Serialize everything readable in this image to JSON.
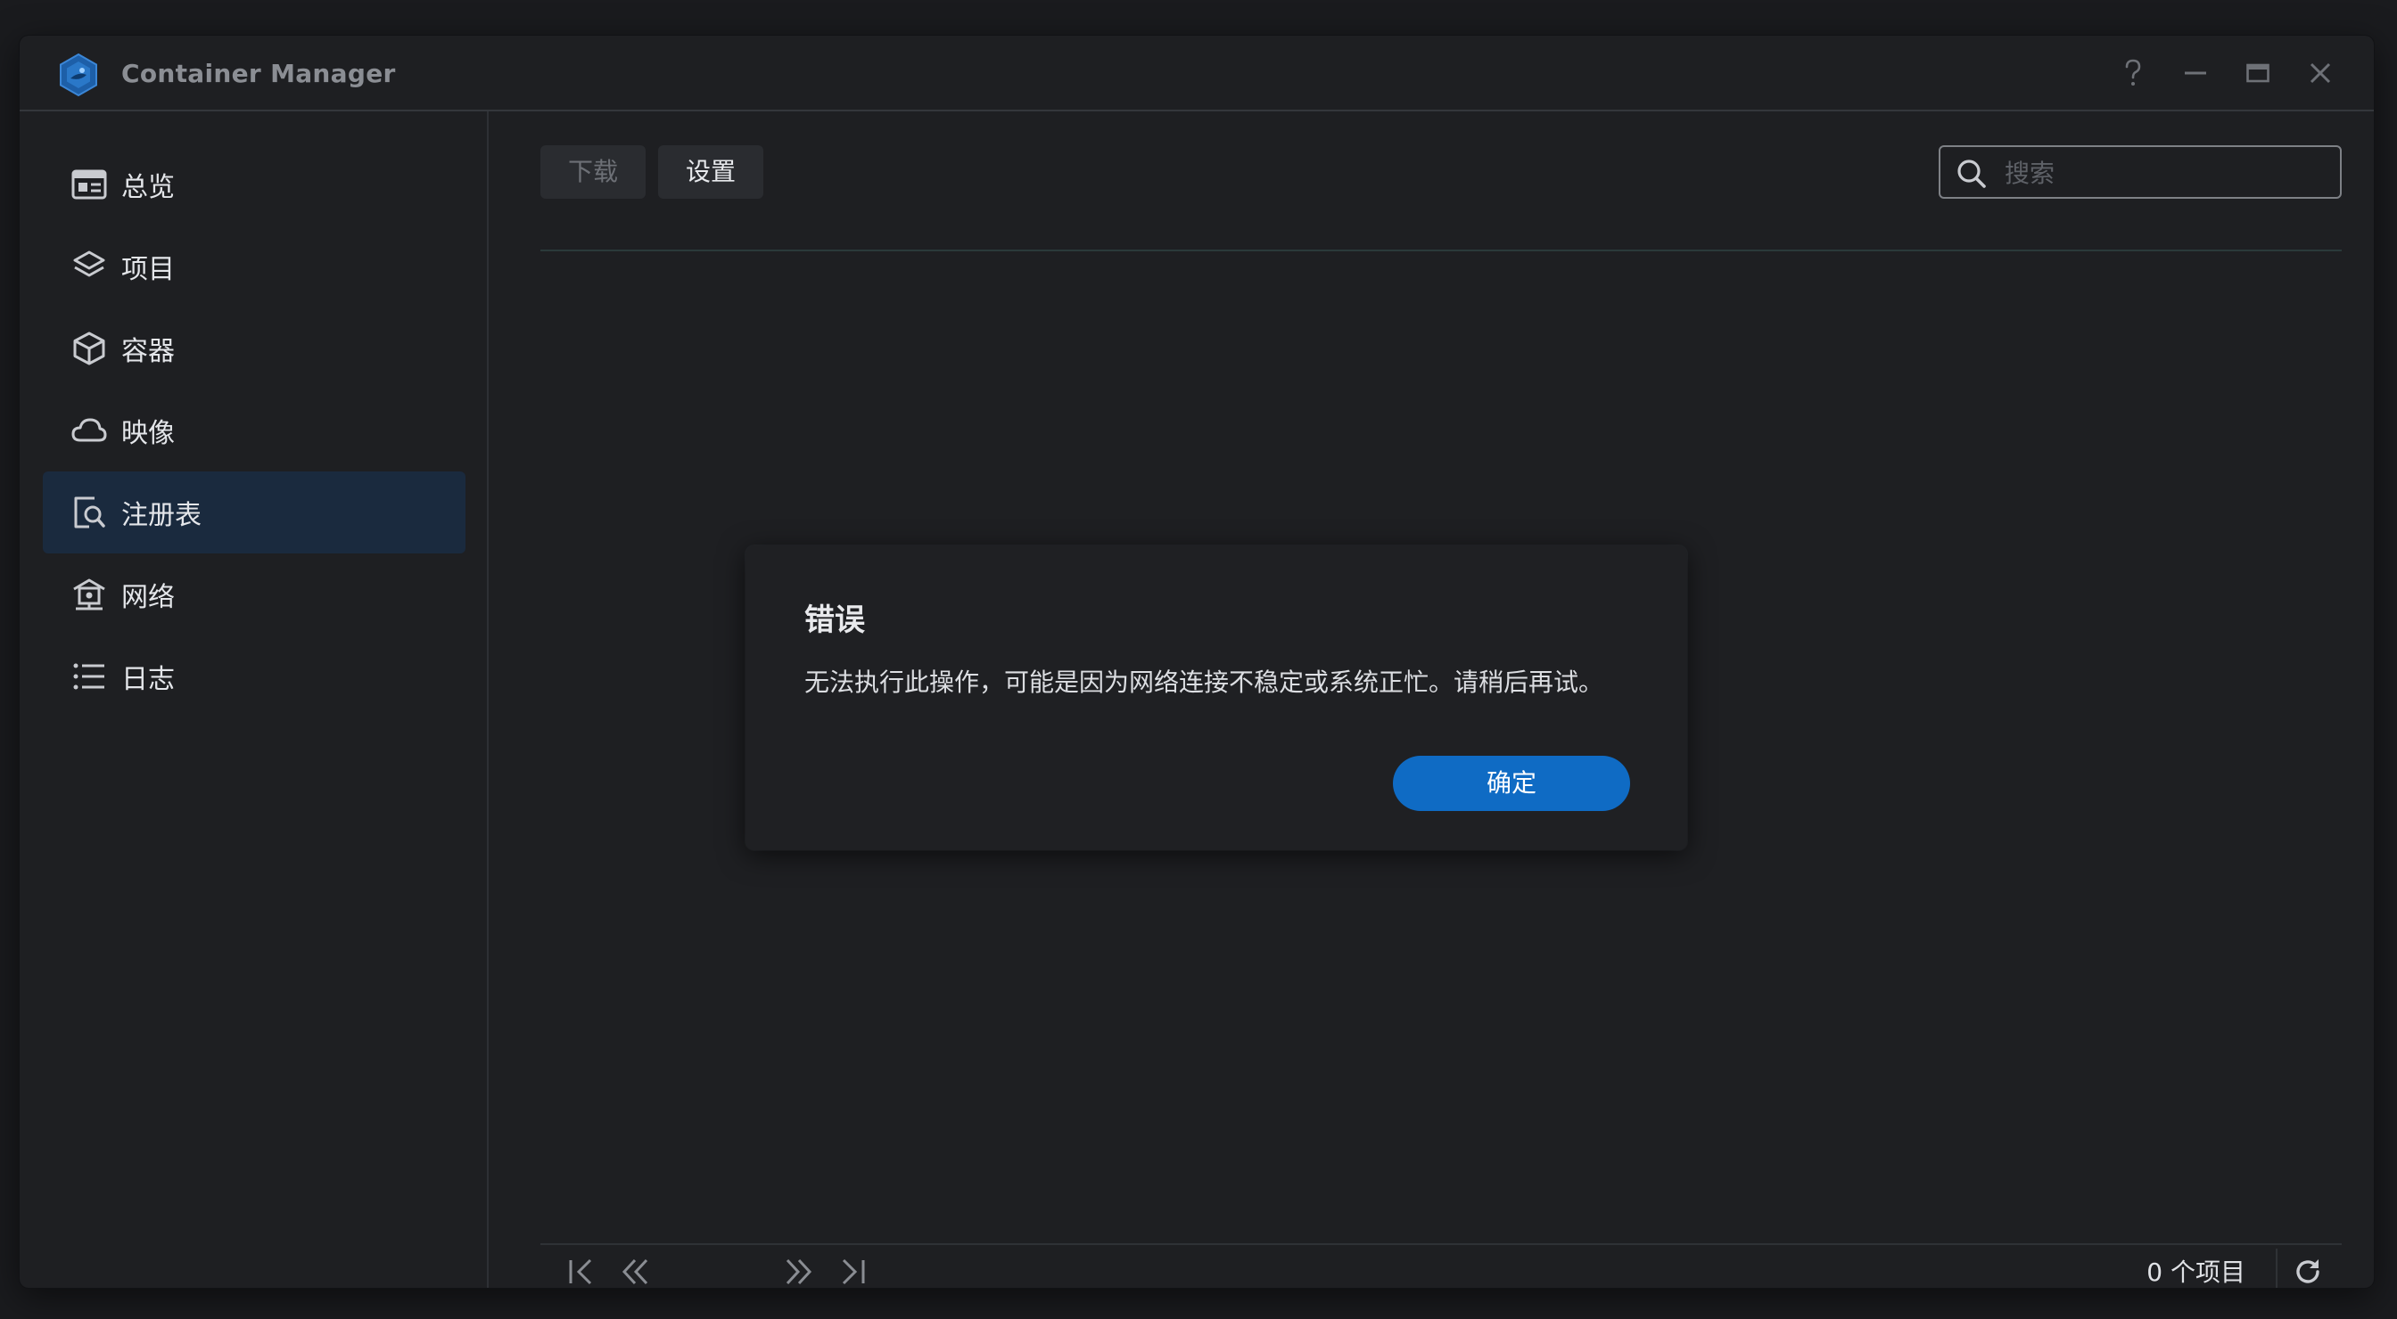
{
  "window": {
    "title": "Container Manager",
    "controls": [
      "help-icon",
      "minimize-icon",
      "maximize-icon",
      "close-icon"
    ]
  },
  "sidebar": {
    "items": [
      {
        "label": "总览",
        "icon": "overview-icon",
        "active": false
      },
      {
        "label": "项目",
        "icon": "layers-icon",
        "active": false
      },
      {
        "label": "容器",
        "icon": "cube-icon",
        "active": false
      },
      {
        "label": "映像",
        "icon": "cloud-icon",
        "active": false
      },
      {
        "label": "注册表",
        "icon": "registry-search-icon",
        "active": true
      },
      {
        "label": "网络",
        "icon": "network-house-icon",
        "active": false
      },
      {
        "label": "日志",
        "icon": "list-icon",
        "active": false
      }
    ]
  },
  "toolbar": {
    "download_label": "下载",
    "settings_label": "设置",
    "search_placeholder": "搜索"
  },
  "footer": {
    "item_count": "0 个项目"
  },
  "dialog": {
    "title": "错误",
    "message": "无法执行此操作，可能是因为网络连接不稳定或系统正忙。请稍后再试。",
    "ok_label": "确定"
  },
  "colors": {
    "accent": "#0f6bc4",
    "active_nav_bg": "#1a2a3e",
    "window_bg": "#1e1f22"
  }
}
